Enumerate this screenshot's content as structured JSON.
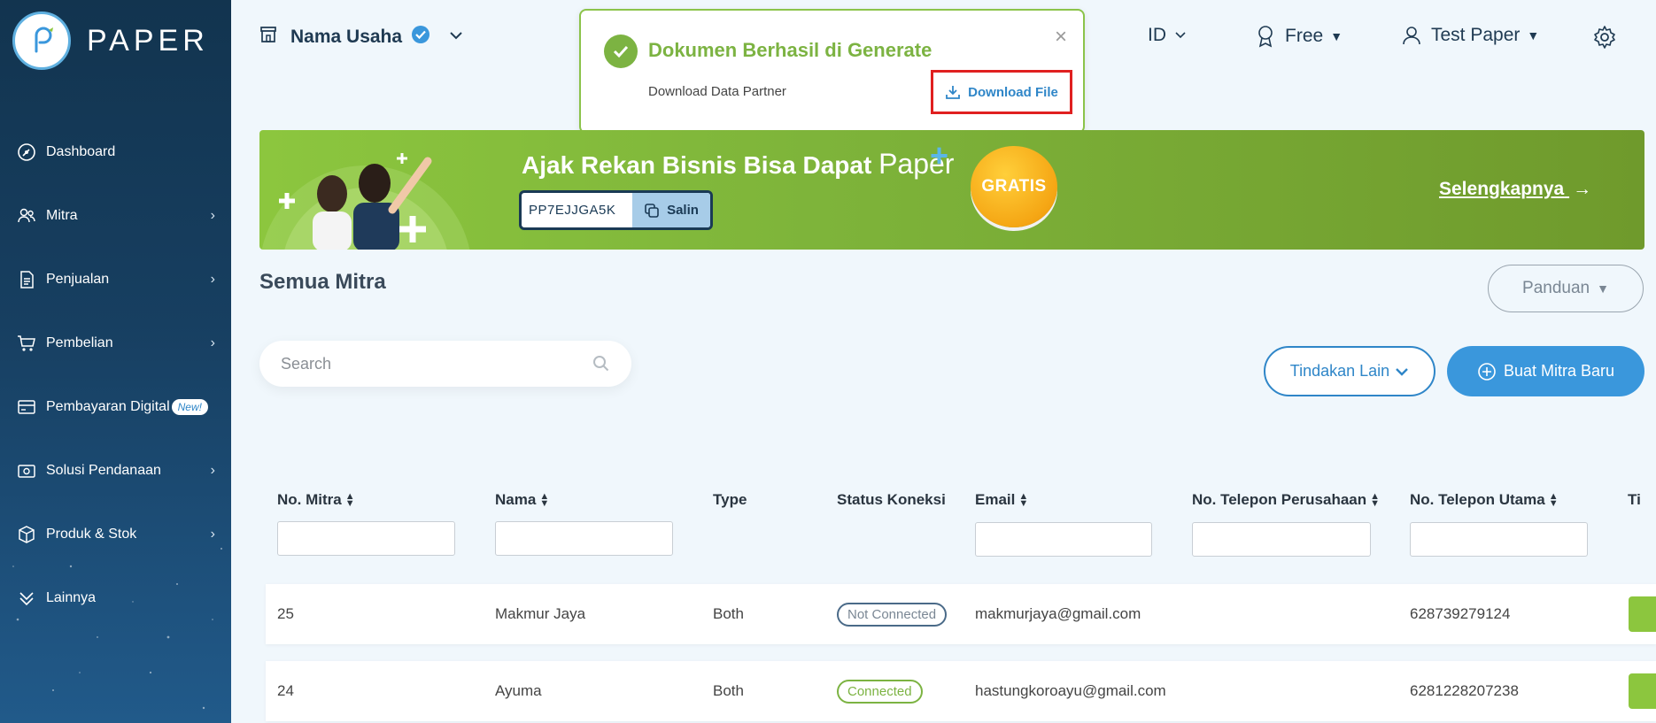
{
  "app": {
    "logo_text": "PAPER"
  },
  "sidebar": {
    "items": [
      {
        "label": "Dashboard",
        "icon": "dashboard-icon",
        "has_chevron": false
      },
      {
        "label": "Mitra",
        "icon": "partners-icon",
        "has_chevron": true
      },
      {
        "label": "Penjualan",
        "icon": "sales-document-icon",
        "has_chevron": true
      },
      {
        "label": "Pembelian",
        "icon": "cart-icon",
        "has_chevron": true
      },
      {
        "label": "Pembayaran Digital",
        "icon": "card-icon",
        "badge": "New!",
        "has_chevron": true
      },
      {
        "label": "Solusi Pendanaan",
        "icon": "funding-icon",
        "has_chevron": true
      },
      {
        "label": "Produk & Stok",
        "icon": "box-icon",
        "has_chevron": true
      },
      {
        "label": "Lainnya",
        "icon": "more-chevrons-icon",
        "has_chevron": false
      }
    ]
  },
  "header": {
    "business_name": "Nama Usaha",
    "language": "ID",
    "plan": "Free",
    "user": "Test Paper"
  },
  "toast": {
    "title": "Dokumen Berhasil di Generate",
    "message": "Download Data Partner",
    "download_label": "Download File",
    "close_symbol": "×"
  },
  "banner": {
    "headline": "Ajak Rekan Bisnis Bisa Dapat",
    "brand": "Paper",
    "referral_code": "PP7EJJGA5K",
    "copy_label": "Salin",
    "badge": "GRATIS",
    "more_label": "Selengkapnya"
  },
  "page": {
    "title": "Semua Mitra",
    "guide_label": "Panduan",
    "search_placeholder": "Search",
    "other_actions_label": "Tindakan Lain",
    "create_label": "Buat Mitra Baru"
  },
  "table": {
    "columns": [
      "No. Mitra",
      "Nama",
      "Type",
      "Status Koneksi",
      "Email",
      "No. Telepon Perusahaan",
      "No. Telepon Utama",
      "Ti"
    ],
    "rows": [
      {
        "no": "25",
        "nama": "Makmur Jaya",
        "type": "Both",
        "status": "Not Connected",
        "email": "makmurjaya@gmail.com",
        "tel_perusahaan": "",
        "tel_utama": "628739279124"
      },
      {
        "no": "24",
        "nama": "Ayuma",
        "type": "Both",
        "status": "Connected",
        "email": "hastungkoroayu@gmail.com",
        "tel_perusahaan": "",
        "tel_utama": "6281228207238"
      }
    ]
  },
  "colors": {
    "accent_blue": "#2f86c8",
    "success_green": "#7cb342",
    "sidebar_dark": "#12344f",
    "highlight_red": "#e02020"
  }
}
